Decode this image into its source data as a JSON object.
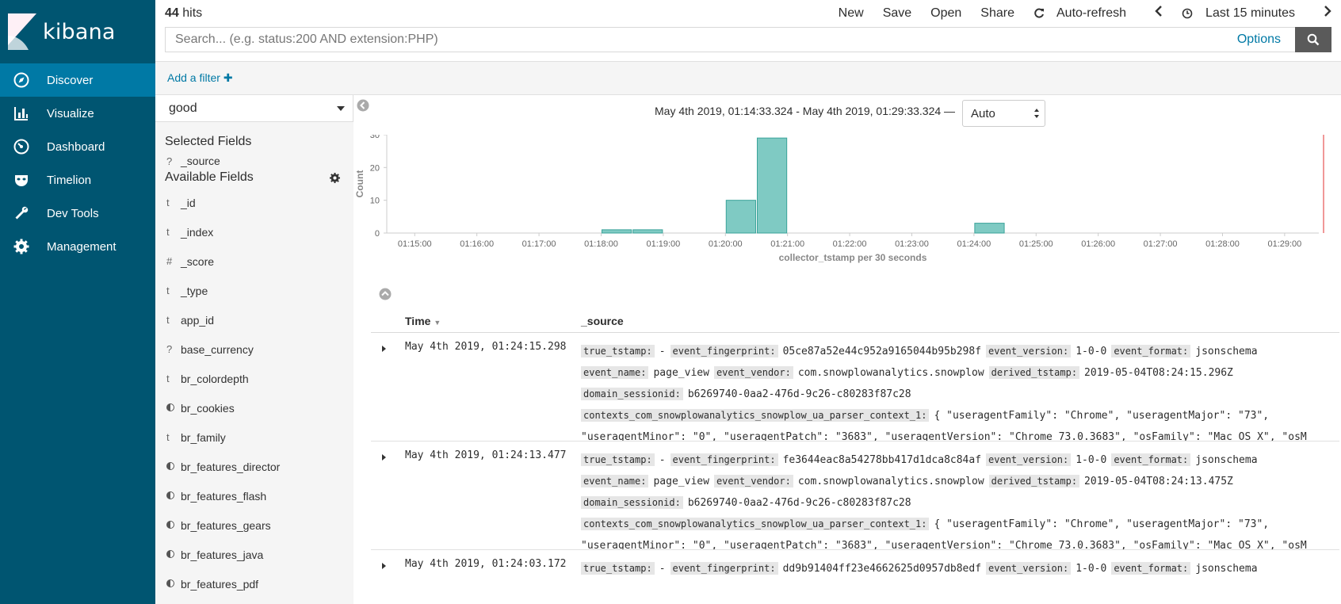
{
  "app": {
    "name": "kibana"
  },
  "sidebar": {
    "items": [
      {
        "label": "Discover",
        "icon": "compass-icon",
        "active": true
      },
      {
        "label": "Visualize",
        "icon": "bar-chart-icon"
      },
      {
        "label": "Dashboard",
        "icon": "dashboard-gauge-icon"
      },
      {
        "label": "Timelion",
        "icon": "timelion-mask-icon"
      },
      {
        "label": "Dev Tools",
        "icon": "wrench-icon"
      },
      {
        "label": "Management",
        "icon": "gear-icon"
      }
    ]
  },
  "topbar": {
    "hits_count": "44",
    "hits_label": "hits",
    "menu": {
      "new": "New",
      "save": "Save",
      "open": "Open",
      "share": "Share",
      "auto_refresh": "Auto-refresh",
      "time": "Last 15 minutes"
    },
    "search_placeholder": "Search... (e.g. status:200 AND extension:PHP)",
    "options": "Options"
  },
  "filterbar": {
    "add_filter": "Add a filter"
  },
  "fields_panel": {
    "index_pattern": "good",
    "selected_title": "Selected Fields",
    "selected": [
      {
        "type": "?",
        "name": "_source"
      }
    ],
    "available_title": "Available Fields",
    "available": [
      {
        "type": "t",
        "name": "_id"
      },
      {
        "type": "t",
        "name": "_index"
      },
      {
        "type": "#",
        "name": "_score"
      },
      {
        "type": "t",
        "name": "_type"
      },
      {
        "type": "t",
        "name": "app_id"
      },
      {
        "type": "?",
        "name": "base_currency"
      },
      {
        "type": "t",
        "name": "br_colordepth"
      },
      {
        "type": "bool",
        "name": "br_cookies"
      },
      {
        "type": "t",
        "name": "br_family"
      },
      {
        "type": "bool",
        "name": "br_features_director"
      },
      {
        "type": "bool",
        "name": "br_features_flash"
      },
      {
        "type": "bool",
        "name": "br_features_gears"
      },
      {
        "type": "bool",
        "name": "br_features_java"
      },
      {
        "type": "bool",
        "name": "br_features_pdf"
      }
    ]
  },
  "main": {
    "time_range": "May 4th 2019, 01:14:33.324 - May 4th 2019, 01:29:33.324 —",
    "interval": "Auto"
  },
  "chart_data": {
    "type": "bar",
    "ylabel": "Count",
    "xlabel": "collector_tstamp per 30 seconds",
    "ylim": [
      0,
      30
    ],
    "yticks": [
      0,
      10,
      20,
      30
    ],
    "xticks": [
      "01:15:00",
      "01:16:00",
      "01:17:00",
      "01:18:00",
      "01:19:00",
      "01:20:00",
      "01:21:00",
      "01:22:00",
      "01:23:00",
      "01:24:00",
      "01:25:00",
      "01:26:00",
      "01:27:00",
      "01:28:00",
      "01:29:00"
    ],
    "x_range_minutes": [
      14.55,
      29.55
    ],
    "bars": [
      {
        "start": "01:18:00",
        "minute": 18.0,
        "value": 1
      },
      {
        "start": "01:18:30",
        "minute": 18.5,
        "value": 1
      },
      {
        "start": "01:20:00",
        "minute": 20.0,
        "value": 10
      },
      {
        "start": "01:20:30",
        "minute": 20.5,
        "value": 29
      },
      {
        "start": "01:24:00",
        "minute": 24.0,
        "value": 3
      }
    ],
    "bar_color": "#7fcac3",
    "now_marker_color": "#e55353"
  },
  "table": {
    "headers": {
      "time": "Time",
      "source": "_source"
    },
    "rows": [
      {
        "time": "May 4th 2019, 01:24:15.298",
        "l1": [
          [
            "true_tstamp:",
            "-"
          ],
          [
            "event_fingerprint:",
            "05ce87a52e44c952a9165044b95b298f"
          ],
          [
            "event_version:",
            "1-0-0"
          ],
          [
            "event_format:",
            "jsonschema"
          ]
        ],
        "l2": [
          [
            "event_name:",
            "page_view"
          ],
          [
            "event_vendor:",
            "com.snowplowanalytics.snowplow"
          ],
          [
            "derived_tstamp:",
            "2019-05-04T08:24:15.296Z"
          ]
        ],
        "l3": [
          [
            "domain_sessionid:",
            "b6269740-0aa2-476d-9c26-c80283f87c28"
          ]
        ],
        "l4": [
          [
            "contexts_com_snowplowanalytics_snowplow_ua_parser_context_1:",
            "{ \"useragentFamily\": \"Chrome\", \"useragentMajor\": \"73\","
          ]
        ],
        "l5": "\"useragentMinor\": \"0\", \"useragentPatch\": \"3683\", \"useragentVersion\": \"Chrome 73.0.3683\", \"osFamily\": \"Mac OS X\", \"osM"
      },
      {
        "time": "May 4th 2019, 01:24:13.477",
        "l1": [
          [
            "true_tstamp:",
            "-"
          ],
          [
            "event_fingerprint:",
            "fe3644eac8a54278bb417d1dca8c84af"
          ],
          [
            "event_version:",
            "1-0-0"
          ],
          [
            "event_format:",
            "jsonschema"
          ]
        ],
        "l2": [
          [
            "event_name:",
            "page_view"
          ],
          [
            "event_vendor:",
            "com.snowplowanalytics.snowplow"
          ],
          [
            "derived_tstamp:",
            "2019-05-04T08:24:13.475Z"
          ]
        ],
        "l3": [
          [
            "domain_sessionid:",
            "b6269740-0aa2-476d-9c26-c80283f87c28"
          ]
        ],
        "l4": [
          [
            "contexts_com_snowplowanalytics_snowplow_ua_parser_context_1:",
            "{ \"useragentFamily\": \"Chrome\", \"useragentMajor\": \"73\","
          ]
        ],
        "l5": "\"useragentMinor\": \"0\", \"useragentPatch\": \"3683\", \"useragentVersion\": \"Chrome 73.0.3683\", \"osFamily\": \"Mac OS X\", \"osM"
      },
      {
        "time": "May 4th 2019, 01:24:03.172",
        "l1": [
          [
            "true_tstamp:",
            "-"
          ],
          [
            "event_fingerprint:",
            "dd9b91404ff23e4662625d0957db8edf"
          ],
          [
            "event_version:",
            "1-0-0"
          ],
          [
            "event_format:",
            "jsonschema"
          ]
        ]
      }
    ]
  }
}
